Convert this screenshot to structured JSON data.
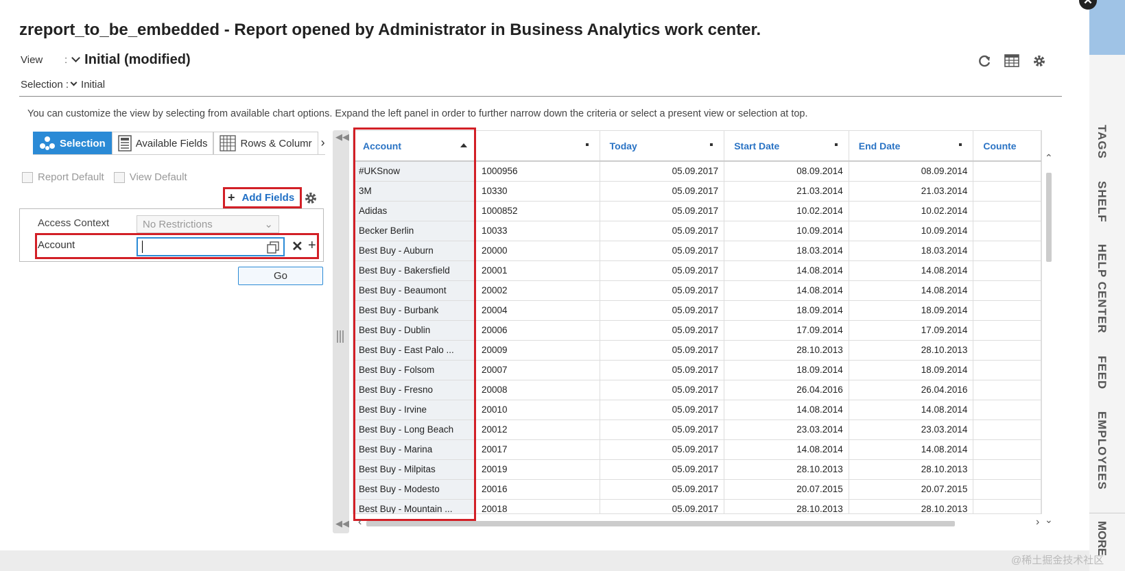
{
  "header": {
    "title": "zreport_to_be_embedded - Report opened by Administrator in Business Analytics work center.",
    "view_label": "View",
    "view_colon": ":",
    "view_value": "Initial (modified)",
    "selection_label": "Selection :",
    "selection_value": "Initial"
  },
  "toolbar_icons": [
    "refresh-icon",
    "table-settings-icon",
    "gear-icon"
  ],
  "info_text": "You can customize the view by selecting from available chart options. Expand the left panel in order to further narrow down the criteria or select a present view or selection at top.",
  "left_panel": {
    "tabs": [
      {
        "label": "Selection",
        "icon": "selection-icon",
        "active": true
      },
      {
        "label": "Available Fields",
        "icon": "fields-icon",
        "active": false
      },
      {
        "label": "Rows & Columr",
        "icon": "grid-icon",
        "active": false
      }
    ],
    "report_default": "Report Default",
    "view_default": "View Default",
    "add_fields": "Add Fields",
    "access_context_label": "Access Context",
    "access_context_value": "No Restrictions",
    "account_label": "Account",
    "account_value": "",
    "go": "Go"
  },
  "grid": {
    "columns": [
      "Account",
      "",
      "Today",
      "Start Date",
      "End Date",
      "Counte"
    ],
    "rows": [
      [
        "#UKSnow",
        "1000956",
        "05.09.2017",
        "08.09.2014",
        "08.09.2014"
      ],
      [
        "3M",
        "10330",
        "05.09.2017",
        "21.03.2014",
        "21.03.2014"
      ],
      [
        "Adidas",
        "1000852",
        "05.09.2017",
        "10.02.2014",
        "10.02.2014"
      ],
      [
        "Becker Berlin",
        "10033",
        "05.09.2017",
        "10.09.2014",
        "10.09.2014"
      ],
      [
        "Best Buy - Auburn",
        "20000",
        "05.09.2017",
        "18.03.2014",
        "18.03.2014"
      ],
      [
        "Best Buy - Bakersfield",
        "20001",
        "05.09.2017",
        "14.08.2014",
        "14.08.2014"
      ],
      [
        "Best Buy - Beaumont",
        "20002",
        "05.09.2017",
        "14.08.2014",
        "14.08.2014"
      ],
      [
        "Best Buy - Burbank",
        "20004",
        "05.09.2017",
        "18.09.2014",
        "18.09.2014"
      ],
      [
        "Best Buy - Dublin",
        "20006",
        "05.09.2017",
        "17.09.2014",
        "17.09.2014"
      ],
      [
        "Best Buy - East Palo ...",
        "20009",
        "05.09.2017",
        "28.10.2013",
        "28.10.2013"
      ],
      [
        "Best Buy - Folsom",
        "20007",
        "05.09.2017",
        "18.09.2014",
        "18.09.2014"
      ],
      [
        "Best Buy - Fresno",
        "20008",
        "05.09.2017",
        "26.04.2016",
        "26.04.2016"
      ],
      [
        "Best Buy - Irvine",
        "20010",
        "05.09.2017",
        "14.08.2014",
        "14.08.2014"
      ],
      [
        "Best Buy - Long Beach",
        "20012",
        "05.09.2017",
        "23.03.2014",
        "23.03.2014"
      ],
      [
        "Best Buy - Marina",
        "20017",
        "05.09.2017",
        "14.08.2014",
        "14.08.2014"
      ],
      [
        "Best Buy - Milpitas",
        "20019",
        "05.09.2017",
        "28.10.2013",
        "28.10.2013"
      ],
      [
        "Best Buy - Modesto",
        "20016",
        "05.09.2017",
        "20.07.2015",
        "20.07.2015"
      ],
      [
        "Best Buy - Mountain ...",
        "20018",
        "05.09.2017",
        "28.10.2013",
        "28.10.2013"
      ]
    ]
  },
  "right_bar": {
    "tabs": [
      "TAGS",
      "SHELF",
      "HELP CENTER",
      "FEED",
      "EMPLOYEES"
    ],
    "more": "MORE"
  },
  "watermark": "@稀土掘金技术社区",
  "colors": {
    "accent": "#2a8ad6",
    "highlight": "#d21f26",
    "link": "#2a73c4"
  }
}
